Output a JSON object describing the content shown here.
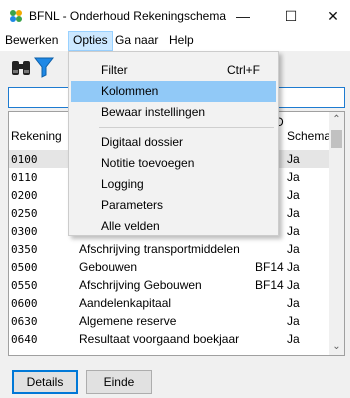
{
  "window": {
    "title": "BFNL - Onderhoud Rekeningschema",
    "minimize": "—",
    "maximize": "☐",
    "close": "✕"
  },
  "menubar": [
    "Bewerken",
    "Opties",
    "Ga naar",
    "Help"
  ],
  "toolbar": {
    "icons": [
      "binoculars-icon",
      "filter-icon"
    ],
    "accent": "#1e88e5"
  },
  "search": {
    "value": ""
  },
  "grid": {
    "headers": {
      "code": "Rekening",
      "dd": "D",
      "schema": "Schema"
    },
    "rows": [
      {
        "code": "0100",
        "omschr": "",
        "dd": "",
        "schema": "Ja"
      },
      {
        "code": "0110",
        "omschr": "",
        "dd": "",
        "schema": "Ja"
      },
      {
        "code": "0200",
        "omschr": "",
        "dd": "",
        "schema": "Ja"
      },
      {
        "code": "0250",
        "omschr": "",
        "dd": "",
        "schema": "Ja"
      },
      {
        "code": "0300",
        "omschr": "",
        "dd": "",
        "schema": "Ja"
      },
      {
        "code": "0350",
        "omschr": "Afschrijving transportmiddelen",
        "dd": "",
        "schema": "Ja"
      },
      {
        "code": "0500",
        "omschr": "Gebouwen",
        "dd": "BF14",
        "schema": "Ja"
      },
      {
        "code": "0550",
        "omschr": "Afschrijving Gebouwen",
        "dd": "BF14",
        "schema": "Ja"
      },
      {
        "code": "0600",
        "omschr": "Aandelenkapitaal",
        "dd": "",
        "schema": "Ja"
      },
      {
        "code": "0630",
        "omschr": "Algemene reserve",
        "dd": "",
        "schema": "Ja"
      },
      {
        "code": "0640",
        "omschr": "Resultaat voorgaand boekjaar",
        "dd": "",
        "schema": "Ja"
      }
    ]
  },
  "buttons": {
    "details": "Details",
    "einde": "Einde"
  },
  "opties_menu": [
    {
      "label": "Filter",
      "shortcut": "Ctrl+F"
    },
    {
      "label": "Kolommen",
      "shortcut": ""
    },
    {
      "label": "Bewaar instellingen",
      "shortcut": ""
    },
    {
      "label": "Digitaal dossier",
      "shortcut": ""
    },
    {
      "label": "Notitie toevoegen",
      "shortcut": ""
    },
    {
      "label": "Logging",
      "shortcut": ""
    },
    {
      "label": "Parameters",
      "shortcut": ""
    },
    {
      "label": "Alle velden",
      "shortcut": ""
    }
  ]
}
